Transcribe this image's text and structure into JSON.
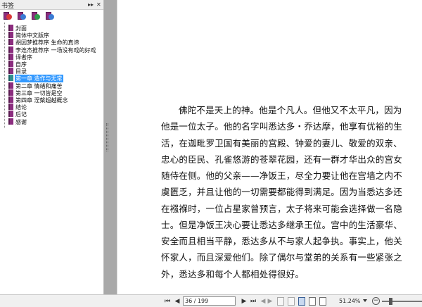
{
  "sidebar": {
    "title": "书签",
    "collapse_icon": "double-chevron-right-icon",
    "close_icon": "close-icon",
    "collapse_glyph": "▸▸",
    "close_glyph": "✕",
    "tools": [
      {
        "icon": "bookmark-expand-icon",
        "badge_color": "#d93a3a"
      },
      {
        "icon": "bookmark-find-icon",
        "badge_color": "#3a7bd5"
      },
      {
        "icon": "bookmark-add-icon",
        "badge_color": "#2e9c4b"
      },
      {
        "icon": "bookmark-options-icon",
        "badge_color": "#3a7bd5"
      }
    ],
    "items": [
      {
        "label": "封面"
      },
      {
        "label": "简体中文版序"
      },
      {
        "label": "胡因梦推荐序 生命的真谛"
      },
      {
        "label": "李连杰推荐序 一场没有戏的好戏"
      },
      {
        "label": "译者序"
      },
      {
        "label": "自序"
      },
      {
        "label": "目录"
      },
      {
        "label": "第一章 造作与无常",
        "selected": true
      },
      {
        "label": "第二章 情绪和痛苦"
      },
      {
        "label": "第三章 一切皆是空"
      },
      {
        "label": "第四章 涅槃超越概念"
      },
      {
        "label": "结论"
      },
      {
        "label": "后记"
      },
      {
        "label": "感谢"
      }
    ]
  },
  "document": {
    "lines": [
      "佛陀不是天上的神。他是个凡人。但他又不太平凡，因为",
      "他是一位太子。他的名字叫悉达多・乔达摩，他享有优裕的生",
      "活，在迦毗罗卫国有美丽的宫殿、钟爱的妻儿、敬爱的双亲、",
      "忠心的臣民、孔雀悠游的苍翠花园，还有一群才华出众的宫女",
      "随侍在侧。他的父亲——净饭王，尽全力要让他在宫墙之内不",
      "虞匮乏，并且让他的一切需要都能得到满足。因为当悉达多还",
      "在襁褓时，一位占星家曾预言，太子将来可能会选择做一名隐",
      "士。但是净饭王决心要让悉达多继承王位。宫中的生活豪华、",
      "安全而且相当平静，悉达多从不与家人起争执。事实上，他关",
      "怀家人，而且深爱他们。除了偶尔与堂弟的关系有一些紧张之",
      "外，悉达多和每个人都相处得很好。"
    ]
  },
  "statusbar": {
    "first_page_glyph": "⏮",
    "prev_page_glyph": "◀",
    "next_page_glyph": "▶",
    "last_page_glyph": "⏭",
    "back_glyph": "◀",
    "forward_glyph": "▶",
    "page_indicator": "36 / 199",
    "zoom": "51.24%",
    "zoom_out_glyph": "−",
    "zoom_level_fraction": 0.2
  }
}
